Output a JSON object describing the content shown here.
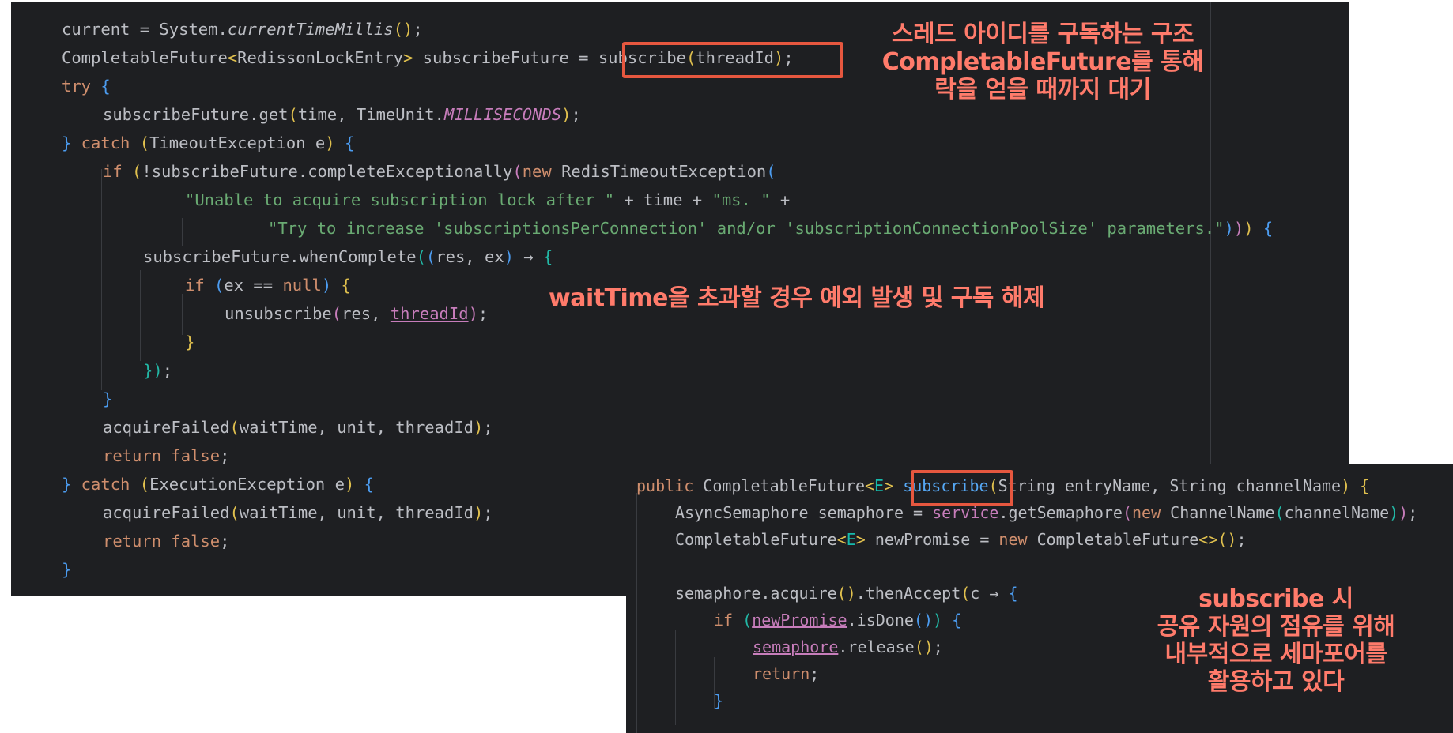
{
  "panel1": {
    "lines": [
      [
        [
          "current = System.",
          ""
        ],
        [
          "currentTimeMillis",
          "ital"
        ],
        [
          "()",
          "p1"
        ],
        [
          ";",
          ""
        ]
      ],
      [
        [
          "CompletableFuture",
          ""
        ],
        [
          "<",
          "p1"
        ],
        [
          "RedissonLockEntry",
          ""
        ],
        [
          ">",
          "p1"
        ],
        [
          " subscribeFuture = ",
          ""
        ],
        [
          "subscribe",
          ""
        ],
        [
          "(",
          "p1"
        ],
        [
          "threadId",
          ""
        ],
        [
          ")",
          "p1"
        ],
        [
          ";",
          ""
        ]
      ],
      [
        [
          "try",
          "kw"
        ],
        [
          " {",
          "p3"
        ]
      ],
      [
        [
          "subscribeFuture.get",
          ""
        ],
        [
          "(",
          "p1"
        ],
        [
          "time, TimeUnit.",
          ""
        ],
        [
          "MILLISECONDS",
          "fld"
        ],
        [
          ")",
          "p1"
        ],
        [
          ";",
          ""
        ]
      ],
      [
        [
          "}",
          "p3"
        ],
        [
          " catch ",
          "kw"
        ],
        [
          "(",
          "p1"
        ],
        [
          "TimeoutException e",
          ""
        ],
        [
          ")",
          "p1"
        ],
        [
          " {",
          "p3"
        ]
      ],
      [
        [
          "if",
          "kw"
        ],
        [
          " (",
          "p1"
        ],
        [
          "!subscribeFuture.completeExceptionally",
          ""
        ],
        [
          "(",
          "p2"
        ],
        [
          "new",
          "kw"
        ],
        [
          " RedisTimeoutException",
          ""
        ],
        [
          "(",
          "p3"
        ]
      ],
      [
        [
          "\"Unable to acquire subscription lock after \"",
          "str"
        ],
        [
          " + time + ",
          ""
        ],
        [
          "\"ms. \"",
          "str"
        ],
        [
          " +",
          ""
        ]
      ],
      [
        [
          "\"Try to increase 'subscriptionsPerConnection' and/or 'subscriptionConnectionPoolSize' parameters.\"",
          "str"
        ],
        [
          ")",
          "p3"
        ],
        [
          ")",
          "p2"
        ],
        [
          ")",
          "p1"
        ],
        [
          " {",
          "p3"
        ]
      ],
      [
        [
          "subscribeFuture.whenComplete",
          ""
        ],
        [
          "(",
          "p4"
        ],
        [
          "(",
          "p3"
        ],
        [
          "res, ex",
          ""
        ],
        [
          ")",
          "p3"
        ],
        [
          " → ",
          ""
        ],
        [
          "{",
          "p4"
        ]
      ],
      [
        [
          "if",
          "kw"
        ],
        [
          " (",
          "p3"
        ],
        [
          "ex == ",
          ""
        ],
        [
          "null",
          "kw"
        ],
        [
          ")",
          "p3"
        ],
        [
          " {",
          "p1"
        ]
      ],
      [
        [
          "unsubscribe",
          ""
        ],
        [
          "(",
          "p2"
        ],
        [
          "res, ",
          ""
        ],
        [
          "threadId",
          "und"
        ],
        [
          ")",
          "p2"
        ],
        [
          ";",
          ""
        ]
      ],
      [
        [
          "}",
          "p1"
        ]
      ],
      [
        [
          "}",
          "p4"
        ],
        [
          ")",
          "p4"
        ],
        [
          ";",
          ""
        ]
      ],
      [
        [
          "}",
          "p3"
        ]
      ],
      [
        [
          "acquireFailed",
          ""
        ],
        [
          "(",
          "p1"
        ],
        [
          "waitTime, unit, threadId",
          ""
        ],
        [
          ")",
          "p1"
        ],
        [
          ";",
          ""
        ]
      ],
      [
        [
          "return",
          "kw"
        ],
        [
          " false",
          "kw"
        ],
        [
          ";",
          ""
        ]
      ],
      [
        [
          "}",
          "p3"
        ],
        [
          " catch ",
          "kw"
        ],
        [
          "(",
          "p1"
        ],
        [
          "ExecutionException e",
          ""
        ],
        [
          ")",
          "p1"
        ],
        [
          " {",
          "p3"
        ]
      ],
      [
        [
          "acquireFailed",
          ""
        ],
        [
          "(",
          "p1"
        ],
        [
          "waitTime, unit, threadId",
          ""
        ],
        [
          ")",
          "p1"
        ],
        [
          ";",
          ""
        ]
      ],
      [
        [
          "return",
          "kw"
        ],
        [
          " false",
          "kw"
        ],
        [
          ";",
          ""
        ]
      ],
      [
        [
          "}",
          "p3"
        ]
      ]
    ]
  },
  "panel2": {
    "lines": [
      [
        [
          "public",
          "kw"
        ],
        [
          " CompletableFuture",
          ""
        ],
        [
          "<",
          "p1"
        ],
        [
          "E",
          "gen"
        ],
        [
          ">",
          "p1"
        ],
        [
          " ",
          ""
        ],
        [
          "subscribe",
          "fn"
        ],
        [
          "(",
          "p1"
        ],
        [
          "String entryName, String channelName",
          ""
        ],
        [
          ")",
          "p1"
        ],
        [
          " {",
          "p1"
        ]
      ],
      [
        [
          "AsyncSemaphore semaphore = ",
          ""
        ],
        [
          "service",
          "p2"
        ],
        [
          ".getSemaphore",
          ""
        ],
        [
          "(",
          "p2"
        ],
        [
          "new",
          "kw"
        ],
        [
          " ChannelName",
          ""
        ],
        [
          "(",
          "p4"
        ],
        [
          "channelName",
          ""
        ],
        [
          ")",
          "p4"
        ],
        [
          ")",
          "p2"
        ],
        [
          ";",
          ""
        ]
      ],
      [
        [
          "CompletableFuture",
          ""
        ],
        [
          "<",
          "p1"
        ],
        [
          "E",
          "gen"
        ],
        [
          ">",
          "p1"
        ],
        [
          " newPromise = ",
          ""
        ],
        [
          "new",
          "kw"
        ],
        [
          " CompletableFuture",
          ""
        ],
        [
          "<>",
          "p1"
        ],
        [
          "()",
          "p1"
        ],
        [
          ";",
          ""
        ]
      ],
      [
        [
          "",
          ""
        ]
      ],
      [
        [
          "semaphore.acquire",
          ""
        ],
        [
          "()",
          "p1"
        ],
        [
          ".thenAccept",
          ""
        ],
        [
          "(",
          "p1"
        ],
        [
          "c → ",
          ""
        ],
        [
          "{",
          "p3"
        ]
      ],
      [
        [
          "if",
          "kw"
        ],
        [
          " (",
          "p4"
        ],
        [
          "newPromise",
          "und"
        ],
        [
          ".isDone",
          ""
        ],
        [
          "()",
          "p3"
        ],
        [
          ")",
          "p4"
        ],
        [
          " {",
          "p3"
        ]
      ],
      [
        [
          "semaphore",
          "und"
        ],
        [
          ".release",
          ""
        ],
        [
          "()",
          "p1"
        ],
        [
          ";",
          ""
        ]
      ],
      [
        [
          "return",
          "kw"
        ],
        [
          ";",
          ""
        ]
      ],
      [
        [
          "}",
          "p3"
        ]
      ]
    ]
  },
  "notes": {
    "top_right": [
      "스레드 아이디를 구독하는 구조",
      "CompletableFuture를 통해",
      "락을 얻을 때까지 대기"
    ],
    "middle": [
      "waitTime을 초과할 경우 예외 발생 및 구독 해제"
    ],
    "bottom_right": [
      "subscribe 시",
      "공유 자원의 점유를 위해",
      "내부적으로 세마포어를",
      "활용하고 있다"
    ]
  },
  "colors": {
    "background": "#1e1f22",
    "annotation": "#ff7b6b",
    "highlight_box": "#e6573f",
    "keyword": "#cf8e6d",
    "string": "#6aab73"
  }
}
